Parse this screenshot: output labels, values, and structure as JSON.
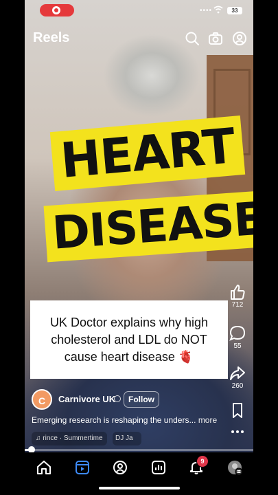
{
  "status_bar": {
    "battery": "33",
    "signal": "••••"
  },
  "header": {
    "title": "Reels"
  },
  "overlay": {
    "line1": "HEART",
    "line2": "DISEASE"
  },
  "caption": {
    "text": "UK Doctor explains why high cholesterol and LDL do NOT cause heart disease 🫀"
  },
  "side": {
    "likes": "712",
    "comments": "55",
    "shares": "260"
  },
  "account": {
    "avatar_letter": "C",
    "name": "Carnivore UK",
    "follow_label": "Follow"
  },
  "description": {
    "text": "Emerging research is reshaping the unders...",
    "more": "more"
  },
  "audio": {
    "track": "rince · Summertime",
    "track2": "DJ Ja"
  },
  "progress": {
    "fraction": 0.02
  },
  "nav": {
    "notifications_badge": "9"
  },
  "colors": {
    "highlight": "#f3e21d",
    "rec": "#e5393b",
    "nav_active": "#3d8af7"
  }
}
